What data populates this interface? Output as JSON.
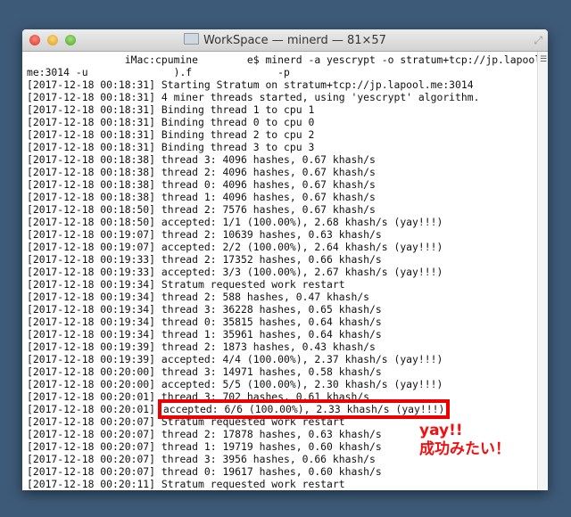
{
  "window": {
    "title": "WorkSpace — minerd — 81×57"
  },
  "command": {
    "line1": "                iMac:cpumine        e$ minerd -a yescrypt -o stratum+tcp://jp.lapool.",
    "line2": "me:3014 -u              ).f              -p"
  },
  "log": [
    "[2017-12-18 00:18:31] Starting Stratum on stratum+tcp://jp.lapool.me:3014",
    "[2017-12-18 00:18:31] 4 miner threads started, using 'yescrypt' algorithm.",
    "[2017-12-18 00:18:31] Binding thread 1 to cpu 1",
    "[2017-12-18 00:18:31] Binding thread 0 to cpu 0",
    "[2017-12-18 00:18:31] Binding thread 2 to cpu 2",
    "[2017-12-18 00:18:31] Binding thread 3 to cpu 3",
    "[2017-12-18 00:18:38] thread 3: 4096 hashes, 0.67 khash/s",
    "[2017-12-18 00:18:38] thread 2: 4096 hashes, 0.67 khash/s",
    "[2017-12-18 00:18:38] thread 0: 4096 hashes, 0.67 khash/s",
    "[2017-12-18 00:18:38] thread 1: 4096 hashes, 0.67 khash/s",
    "[2017-12-18 00:18:50] thread 2: 7576 hashes, 0.67 khash/s",
    "[2017-12-18 00:18:50] accepted: 1/1 (100.00%), 2.68 khash/s (yay!!!)",
    "[2017-12-18 00:19:07] thread 2: 10639 hashes, 0.63 khash/s",
    "[2017-12-18 00:19:07] accepted: 2/2 (100.00%), 2.64 khash/s (yay!!!)",
    "[2017-12-18 00:19:33] thread 2: 17352 hashes, 0.66 khash/s",
    "[2017-12-18 00:19:33] accepted: 3/3 (100.00%), 2.67 khash/s (yay!!!)",
    "[2017-12-18 00:19:34] Stratum requested work restart",
    "[2017-12-18 00:19:34] thread 2: 588 hashes, 0.47 khash/s",
    "[2017-12-18 00:19:34] thread 3: 36228 hashes, 0.65 khash/s",
    "[2017-12-18 00:19:34] thread 0: 35815 hashes, 0.64 khash/s",
    "[2017-12-18 00:19:34] thread 1: 35961 hashes, 0.64 khash/s",
    "[2017-12-18 00:19:39] thread 2: 1873 hashes, 0.43 khash/s",
    "[2017-12-18 00:19:39] accepted: 4/4 (100.00%), 2.37 khash/s (yay!!!)",
    "[2017-12-18 00:20:00] thread 3: 14971 hashes, 0.58 khash/s",
    "[2017-12-18 00:20:00] accepted: 5/5 (100.00%), 2.30 khash/s (yay!!!)",
    "[2017-12-18 00:20:01] thread 3: 702 hashes, 0.61 khash/s",
    "[2017-12-18 00:20:01] ",
    "[2017-12-18 00:20:07] Stratum requested work restart",
    "[2017-12-18 00:20:07] thread 2: 17878 hashes, 0.63 khash/s",
    "[2017-12-18 00:20:07] thread 1: 19719 hashes, 0.60 khash/s",
    "[2017-12-18 00:20:07] thread 3: 3956 hashes, 0.66 khash/s",
    "[2017-12-18 00:20:07] thread 0: 19617 hashes, 0.60 khash/s",
    "[2017-12-18 00:20:11] Stratum requested work restart"
  ],
  "highlight": {
    "text": "accepted: 6/6 (100.00%), 2.33 khash/s (yay!!!)",
    "color": "#ee0000"
  },
  "annotation": {
    "line1": "yay!!",
    "line2": "成功みたい！"
  }
}
